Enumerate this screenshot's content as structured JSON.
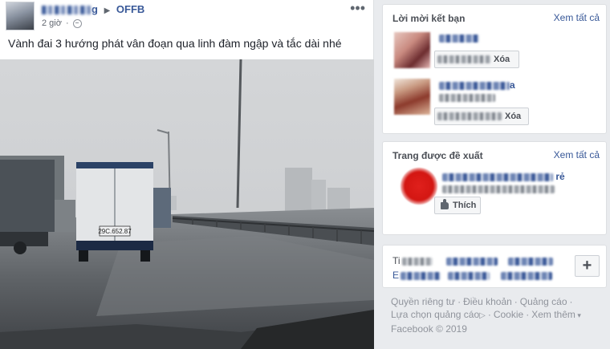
{
  "post": {
    "author_suffix": "g",
    "group_name": "OFFB",
    "timestamp": "2 giờ",
    "more_icon": "more-horizontal-icon",
    "text": "Vành đai 3 hướng phát vân đoạn qua linh đàm ngập và tắc dài nhé",
    "photo": {
      "plate": "29C.652.87"
    }
  },
  "friend_requests": {
    "title": "Lời mời kết bạn",
    "see_all": "Xem tất cả",
    "items": [
      {
        "delete_label": "Xóa",
        "name_suffix": ""
      },
      {
        "delete_label": "Xóa",
        "name_suffix": "a"
      }
    ]
  },
  "suggested_pages": {
    "title": "Trang được đề xuất",
    "see_all": "Xem tất cả",
    "items": [
      {
        "name_suffix": "rẻ",
        "like_label": "Thích"
      }
    ]
  },
  "language_card": {
    "line1_prefix": "Ti",
    "line2_prefix": "E",
    "add_icon": "plus-icon"
  },
  "footer": {
    "links": [
      "Quyền riêng tư",
      "Điều khoản",
      "Quảng cáo",
      "Lựa chọn quảng cáo",
      "Cookie",
      "Xem thêm"
    ],
    "ad_choices_icon": "ad-choices-icon",
    "copyright": "Facebook © 2019"
  },
  "colors": {
    "link": "#385898",
    "page_bg": "#e9ebee",
    "text": "#1d2129",
    "muted": "#90949c"
  }
}
